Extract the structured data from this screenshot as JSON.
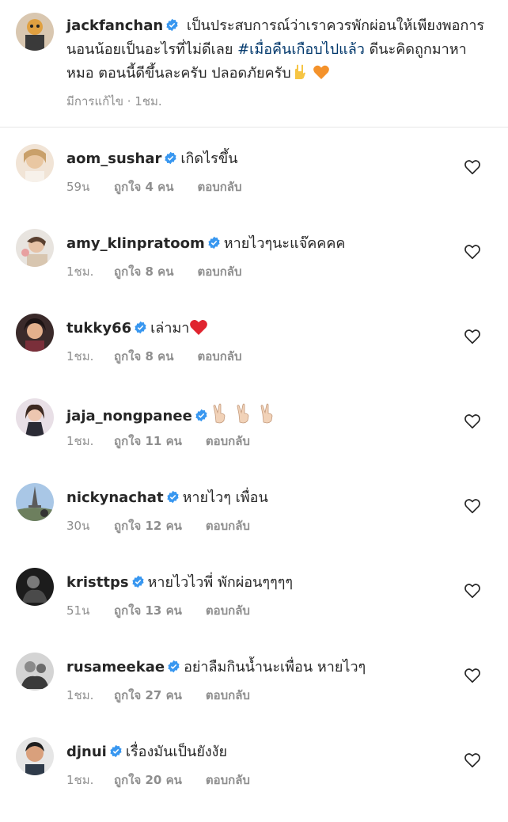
{
  "caption": {
    "username": "jackfanchan",
    "text_before": " เป็นประสบการณ์ว่าเราควรพักผ่อนให้เพียงพอการนอนน้อยเป็นอะไรที่ไม่ดีเลย ",
    "hashtag": "#เมื่อคืนเกือบไปแล้ว",
    "text_after": " ดีนะคิดถูกมาหาหมอ ตอนนี้ดีขึ้นละครับ ปลอดภัยครับ",
    "emojis": [
      "rock-on-hand-icon",
      "orange-heart-icon"
    ],
    "meta": "มีการแก้ไข · 1ชม."
  },
  "comments": [
    {
      "username": "aom_sushar",
      "text": "เกิดไรขึ้น",
      "time": "59น",
      "likes": "ถูกใจ 4 คน",
      "reply": "ตอบกลับ"
    },
    {
      "username": "amy_klinpratoom",
      "text": "หายไวๆนะแจ๊คคคค",
      "time": "1ชม.",
      "likes": "ถูกใจ 8 คน",
      "reply": "ตอบกลับ"
    },
    {
      "username": "tukky66",
      "text": "เล่ามา",
      "time": "1ชม.",
      "likes": "ถูกใจ 8 คน",
      "reply": "ตอบกลับ",
      "emoji": "red-heart-icon"
    },
    {
      "username": "jaja_nongpanee",
      "text": "",
      "time": "1ชม.",
      "likes": "ถูกใจ 11 คน",
      "reply": "ตอบกลับ",
      "emoji": "victory-hand-icon"
    },
    {
      "username": "nickynachat",
      "text": "หายไวๆ เพื่อน",
      "time": "30น",
      "likes": "ถูกใจ 12 คน",
      "reply": "ตอบกลับ"
    },
    {
      "username": "kristtps",
      "text": "หายไวไวพี่ พักผ่อนๆๆๆๆ",
      "time": "51น",
      "likes": "ถูกใจ 13 คน",
      "reply": "ตอบกลับ"
    },
    {
      "username": "rusameekae",
      "text": "อย่าลืมกินน้ำนะเพื่อน หายไวๆ",
      "time": "1ชม.",
      "likes": "ถูกใจ 27 คน",
      "reply": "ตอบกลับ"
    },
    {
      "username": "djnui",
      "text": "เรื่องมันเป็นยังงัย",
      "time": "1ชม.",
      "likes": "ถูกใจ 20 คน",
      "reply": "ตอบกลับ"
    }
  ],
  "colors": {
    "verified": "#3897f0",
    "hashtag": "#00376b",
    "meta": "#8e8e8e",
    "text": "#262626"
  }
}
